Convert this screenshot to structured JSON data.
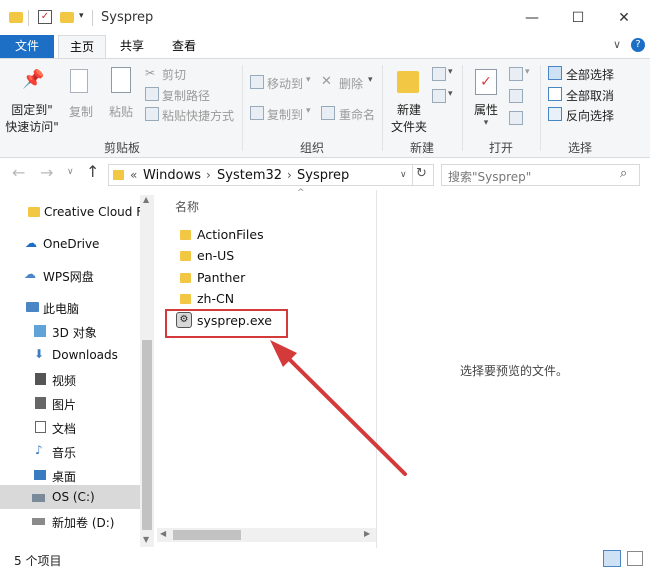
{
  "window": {
    "title": "Sysprep",
    "minimize": "—",
    "maximize": "☐",
    "close": "✕"
  },
  "tabs": {
    "file": "文件",
    "home": "主页",
    "share": "共享",
    "view": "查看"
  },
  "ribbon": {
    "pin_line1": "固定到\"",
    "pin_line2": "快速访问\"",
    "copy": "复制",
    "paste": "粘贴",
    "cut": "剪切",
    "copy_path": "复制路径",
    "paste_shortcut": "粘贴快捷方式",
    "clipboard_group": "剪贴板",
    "move_to": "移动到",
    "copy_to": "复制到",
    "delete": "删除",
    "rename": "重命名",
    "organize_group": "组织",
    "new_folder_line1": "新建",
    "new_folder_line2": "文件夹",
    "new_group": "新建",
    "properties": "属性",
    "open_group": "打开",
    "select_all": "全部选择",
    "select_none": "全部取消",
    "invert_selection": "反向选择",
    "select_group": "选择"
  },
  "address": {
    "overflow": "«",
    "crumbs": [
      "Windows",
      "System32",
      "Sysprep"
    ],
    "search_placeholder": "搜索\"Sysprep\""
  },
  "nav": {
    "items": [
      {
        "label": "Creative Cloud F"
      },
      {
        "label": "OneDrive"
      },
      {
        "label": "WPS网盘"
      },
      {
        "label": "此电脑"
      },
      {
        "label": "3D 对象"
      },
      {
        "label": "Downloads"
      },
      {
        "label": "视频"
      },
      {
        "label": "图片"
      },
      {
        "label": "文档"
      },
      {
        "label": "音乐"
      },
      {
        "label": "桌面"
      },
      {
        "label": "OS (C:)"
      },
      {
        "label": "新加卷 (D:)"
      }
    ]
  },
  "files": {
    "column_name": "名称",
    "items": [
      {
        "name": "ActionFiles"
      },
      {
        "name": "en-US"
      },
      {
        "name": "Panther"
      },
      {
        "name": "zh-CN"
      },
      {
        "name": "sysprep.exe"
      }
    ]
  },
  "preview": {
    "message": "选择要预览的文件。"
  },
  "status": {
    "count": "5 个项目"
  },
  "colors": {
    "file_tab": "#1c6fc4",
    "folder": "#f2c744",
    "annotation": "#d43a3a"
  }
}
